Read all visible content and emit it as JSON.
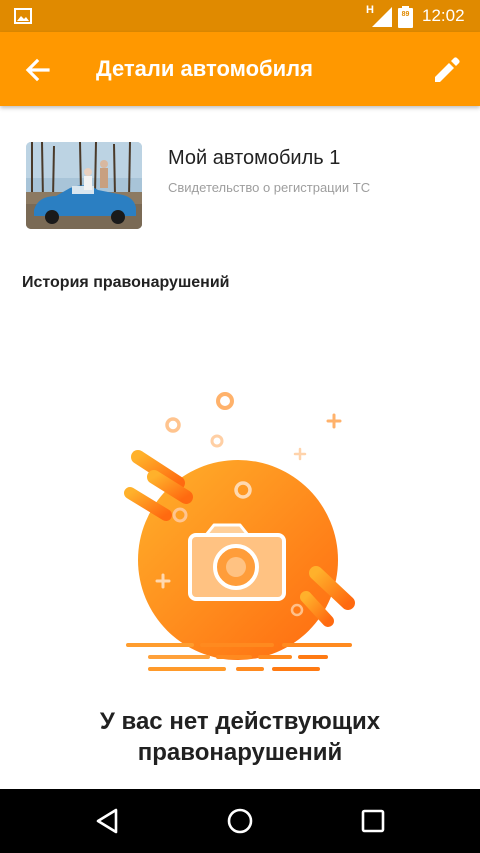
{
  "status_bar": {
    "time": "12:02",
    "network_type": "H",
    "battery_level": "89",
    "icons": [
      "image-notification-icon",
      "signal-icon",
      "battery-icon"
    ]
  },
  "app_bar": {
    "title": "Детали автомобиля",
    "back_icon": "arrow-back-icon",
    "edit_icon": "pencil-icon"
  },
  "car": {
    "name": "Мой автомобиль 1",
    "subtitle": "Свидетельство о регистрации ТС"
  },
  "history": {
    "section_title": "История правонарушений",
    "empty_line1": "У вас нет действующих",
    "empty_line2": "правонарушений"
  },
  "nav_bar": {
    "icons": [
      "back-triangle-icon",
      "home-circle-icon",
      "recents-square-icon"
    ]
  },
  "colors": {
    "primary": "#ff9800",
    "status_bar": "#e08a00",
    "gradient_start": "#ffb12b",
    "gradient_end": "#ff6a10"
  }
}
